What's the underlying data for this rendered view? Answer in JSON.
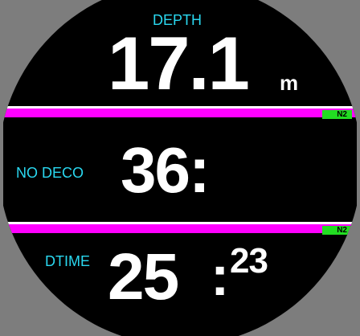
{
  "depth": {
    "label": "DEPTH",
    "value": "17.1",
    "unit": "m"
  },
  "ndl": {
    "label": "NO DECO",
    "value": "36:"
  },
  "dtime": {
    "label": "DTIME",
    "minutes": "25",
    "sep": ":",
    "seconds": "23"
  },
  "gas_bars": [
    {
      "gas": "N2"
    },
    {
      "gas": "N2"
    }
  ],
  "colors": {
    "label": "#2ad8f0",
    "value": "#ffffff",
    "bar": "#ff00ff",
    "gas": "#22dd22",
    "background": "#000000",
    "bezel": "#7d7d7d"
  }
}
